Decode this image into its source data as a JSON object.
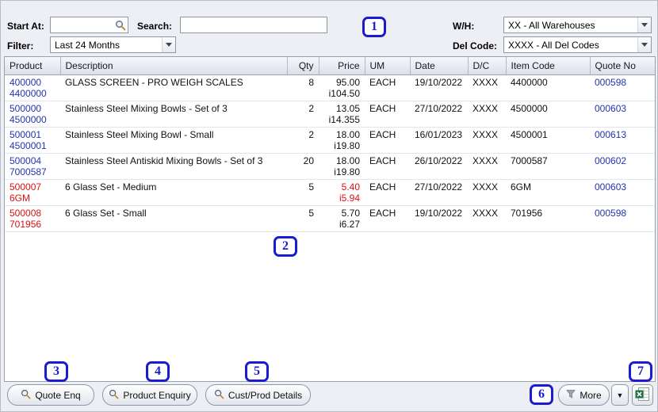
{
  "colors": {
    "window_bg": "#edeff5",
    "link_blue": "#2433b0",
    "alert_red": "#dd1111",
    "badge_blue": "#1b1bd1",
    "excel_green": "#1f7244"
  },
  "toolbar": {
    "start_at_label": "Start At:",
    "start_at_value": "",
    "search_label": "Search:",
    "search_value": "",
    "filter_label": "Filter:",
    "filter_value": "Last 24 Months",
    "wh_label": "W/H:",
    "wh_value": "XX - All Warehouses",
    "del_code_label": "Del Code:",
    "del_code_value": "XXXX - All Del Codes"
  },
  "table": {
    "columns": [
      "Product",
      "Description",
      "Qty",
      "Price",
      "UM",
      "Date",
      "D/C",
      "Item Code",
      "Quote No"
    ],
    "rows": [
      {
        "product_line1": "400000",
        "product_line2": "4400000",
        "product_color": "blue",
        "description": "GLASS SCREEN - PRO WEIGH SCALES",
        "qty": "8",
        "price_line1": "95.00",
        "price_line2": "i104.50",
        "price_color": "black",
        "um": "EACH",
        "date": "19/10/2022",
        "dc": "XXXX",
        "item_code": "4400000",
        "quote_no": "000598"
      },
      {
        "product_line1": "500000",
        "product_line2": "4500000",
        "product_color": "blue",
        "description": "Stainless Steel Mixing Bowls - Set of 3",
        "qty": "2",
        "price_line1": "13.05",
        "price_line2": "i14.355",
        "price_color": "black",
        "um": "EACH",
        "date": "27/10/2022",
        "dc": "XXXX",
        "item_code": "4500000",
        "quote_no": "000603"
      },
      {
        "product_line1": "500001",
        "product_line2": "4500001",
        "product_color": "blue",
        "description": "Stainless Steel Mixing Bowl - Small",
        "qty": "2",
        "price_line1": "18.00",
        "price_line2": "i19.80",
        "price_color": "black",
        "um": "EACH",
        "date": "16/01/2023",
        "dc": "XXXX",
        "item_code": "4500001",
        "quote_no": "000613"
      },
      {
        "product_line1": "500004",
        "product_line2": "7000587",
        "product_color": "blue",
        "description": "Stainless Steel Antiskid Mixing Bowls - Set of 3",
        "qty": "20",
        "price_line1": "18.00",
        "price_line2": "i19.80",
        "price_color": "black",
        "um": "EACH",
        "date": "26/10/2022",
        "dc": "XXXX",
        "item_code": "7000587",
        "quote_no": "000602"
      },
      {
        "product_line1": "500007",
        "product_line2": "6GM",
        "product_color": "red",
        "description": "6 Glass Set - Medium",
        "qty": "5",
        "price_line1": "5.40",
        "price_line2": "i5.94",
        "price_color": "red",
        "um": "EACH",
        "date": "27/10/2022",
        "dc": "XXXX",
        "item_code": "6GM",
        "quote_no": "000603"
      },
      {
        "product_line1": "500008",
        "product_line2": "701956",
        "product_color": "red",
        "description": "6 Glass Set - Small",
        "qty": "5",
        "price_line1": "5.70",
        "price_line2": "i6.27",
        "price_color": "black",
        "um": "EACH",
        "date": "19/10/2022",
        "dc": "XXXX",
        "item_code": "701956",
        "quote_no": "000598"
      }
    ]
  },
  "buttons": {
    "quote_enq": "Quote Enq",
    "product_enquiry": "Product Enquiry",
    "cust_prod_details": "Cust/Prod Details",
    "more": "More",
    "more_caret": "▼"
  },
  "icons": {
    "search": "magnifier",
    "more": "funnel",
    "excel": "spreadsheet-export",
    "combo_arrow": "chevron-down"
  },
  "annotations": [
    "1",
    "2",
    "3",
    "4",
    "5",
    "6",
    "7"
  ]
}
